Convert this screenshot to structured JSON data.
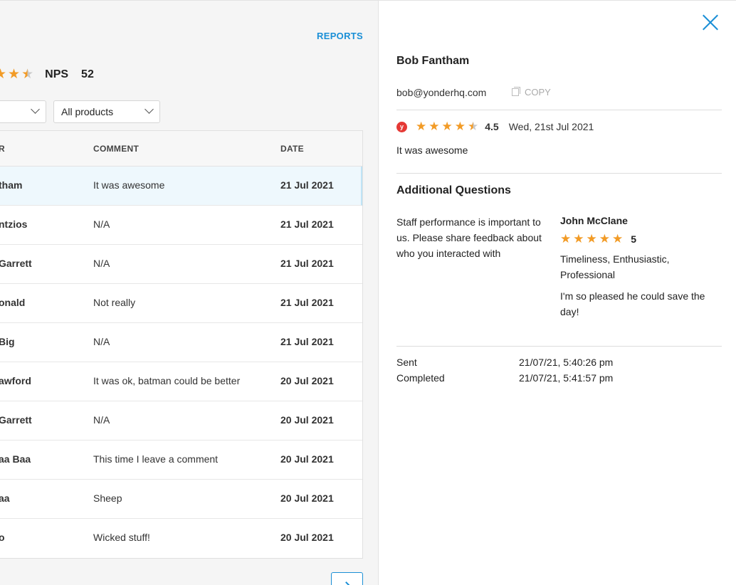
{
  "left": {
    "reports_link": "REPORTS",
    "summary": {
      "stars": 4.5,
      "nps_label": "NPS",
      "nps_value": "52"
    },
    "filters": {
      "products": "All products"
    },
    "table": {
      "headers": {
        "name": "R",
        "comment": "COMMENT",
        "date": "DATE"
      },
      "rows": [
        {
          "name": "tham",
          "comment": "It was awesome",
          "date": "21 Jul 2021",
          "selected": true
        },
        {
          "name": "ntzios",
          "comment": "N/A",
          "date": "21 Jul 2021"
        },
        {
          "name": "Garrett",
          "comment": "N/A",
          "date": "21 Jul 2021"
        },
        {
          "name": "onald",
          "comment": "Not really",
          "date": "21 Jul 2021"
        },
        {
          "name": "Big",
          "comment": "N/A",
          "date": "21 Jul 2021"
        },
        {
          "name": "awford",
          "comment": "It was ok, batman could be better",
          "date": "20 Jul 2021"
        },
        {
          "name": "Garrett",
          "comment": "N/A",
          "date": "20 Jul 2021"
        },
        {
          "name": "aa Baa",
          "comment": "This time I leave a comment",
          "date": "20 Jul 2021"
        },
        {
          "name": "aa",
          "comment": "Sheep",
          "date": "20 Jul 2021"
        },
        {
          "name": "o",
          "comment": "Wicked stuff!",
          "date": "20 Jul 2021"
        }
      ]
    }
  },
  "detail": {
    "name": "Bob Fantham",
    "email": "bob@yonderhq.com",
    "copy_label": "COPY",
    "source_icon": "y",
    "rating": "4.5",
    "date": "Wed, 21st Jul 2021",
    "comment": "It was awesome",
    "additional_questions": {
      "title": "Additional Questions",
      "question": "Staff performance is important to us. Please share feedback about who you interacted with",
      "person": "John McClane",
      "score": "5",
      "tags": "Timeliness, Enthusiastic, Professional",
      "comment": "I'm so pleased he could save the day!"
    },
    "meta": {
      "sent_label": "Sent",
      "sent_value": "21/07/21, 5:40:26 pm",
      "completed_label": "Completed",
      "completed_value": "21/07/21, 5:41:57 pm"
    }
  },
  "colors": {
    "accent": "#1a8fd6",
    "star": "#f29b26",
    "selected_row": "#eef8fd"
  }
}
